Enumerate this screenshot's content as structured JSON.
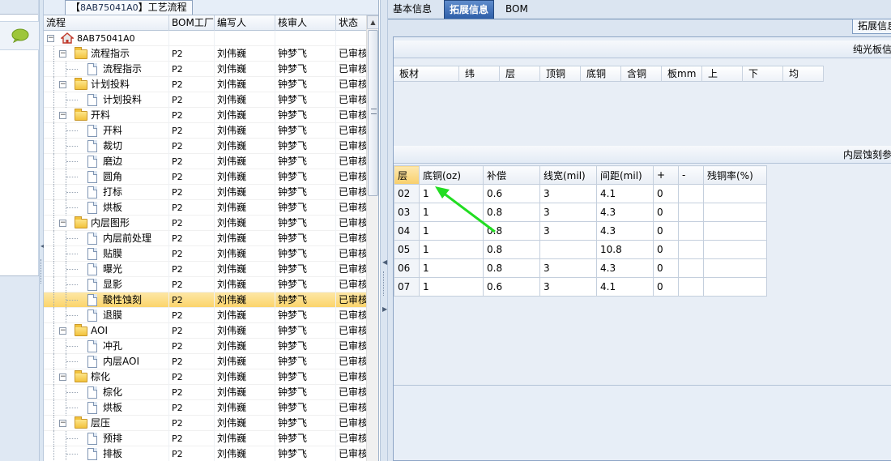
{
  "tree_panel": {
    "title_prefix": "【",
    "title_code": "8AB75041A0",
    "title_suffix": "】工艺流程",
    "columns": [
      "流程",
      "BOM工厂",
      "编写人",
      "核审人",
      "状态"
    ]
  },
  "tree_rows": [
    {
      "name": "8AB75041A0",
      "type": "root",
      "level": 0,
      "factory": "",
      "author": "",
      "reviewer": "",
      "status": ""
    },
    {
      "name": "流程指示",
      "type": "folder",
      "level": 1,
      "factory": "P2",
      "author": "刘伟巍",
      "reviewer": "钟梦飞",
      "status": "已审核"
    },
    {
      "name": "流程指示",
      "type": "doc",
      "level": 2,
      "factory": "P2",
      "author": "刘伟巍",
      "reviewer": "钟梦飞",
      "status": "已审核"
    },
    {
      "name": "计划投料",
      "type": "folder",
      "level": 1,
      "factory": "P2",
      "author": "刘伟巍",
      "reviewer": "钟梦飞",
      "status": "已审核"
    },
    {
      "name": "计划投料",
      "type": "doc",
      "level": 2,
      "factory": "P2",
      "author": "刘伟巍",
      "reviewer": "钟梦飞",
      "status": "已审核"
    },
    {
      "name": "开料",
      "type": "folder",
      "level": 1,
      "factory": "P2",
      "author": "刘伟巍",
      "reviewer": "钟梦飞",
      "status": "已审核"
    },
    {
      "name": "开料",
      "type": "doc",
      "level": 2,
      "factory": "P2",
      "author": "刘伟巍",
      "reviewer": "钟梦飞",
      "status": "已审核"
    },
    {
      "name": "裁切",
      "type": "doc",
      "level": 2,
      "factory": "P2",
      "author": "刘伟巍",
      "reviewer": "钟梦飞",
      "status": "已审核"
    },
    {
      "name": "磨边",
      "type": "doc",
      "level": 2,
      "factory": "P2",
      "author": "刘伟巍",
      "reviewer": "钟梦飞",
      "status": "已审核"
    },
    {
      "name": "圆角",
      "type": "doc",
      "level": 2,
      "factory": "P2",
      "author": "刘伟巍",
      "reviewer": "钟梦飞",
      "status": "已审核"
    },
    {
      "name": "打标",
      "type": "doc",
      "level": 2,
      "factory": "P2",
      "author": "刘伟巍",
      "reviewer": "钟梦飞",
      "status": "已审核"
    },
    {
      "name": "烘板",
      "type": "doc",
      "level": 2,
      "factory": "P2",
      "author": "刘伟巍",
      "reviewer": "钟梦飞",
      "status": "已审核"
    },
    {
      "name": "内层图形",
      "type": "folder",
      "level": 1,
      "factory": "P2",
      "author": "刘伟巍",
      "reviewer": "钟梦飞",
      "status": "已审核"
    },
    {
      "name": "内层前处理",
      "type": "doc",
      "level": 2,
      "factory": "P2",
      "author": "刘伟巍",
      "reviewer": "钟梦飞",
      "status": "已审核"
    },
    {
      "name": "贴膜",
      "type": "doc",
      "level": 2,
      "factory": "P2",
      "author": "刘伟巍",
      "reviewer": "钟梦飞",
      "status": "已审核"
    },
    {
      "name": "曝光",
      "type": "doc",
      "level": 2,
      "factory": "P2",
      "author": "刘伟巍",
      "reviewer": "钟梦飞",
      "status": "已审核"
    },
    {
      "name": "显影",
      "type": "doc",
      "level": 2,
      "factory": "P2",
      "author": "刘伟巍",
      "reviewer": "钟梦飞",
      "status": "已审核"
    },
    {
      "name": "酸性蚀刻",
      "type": "doc",
      "level": 2,
      "factory": "P2",
      "author": "刘伟巍",
      "reviewer": "钟梦飞",
      "status": "已审核",
      "selected": true
    },
    {
      "name": "退膜",
      "type": "doc",
      "level": 2,
      "factory": "P2",
      "author": "刘伟巍",
      "reviewer": "钟梦飞",
      "status": "已审核"
    },
    {
      "name": "AOI",
      "type": "folder",
      "level": 1,
      "factory": "P2",
      "author": "刘伟巍",
      "reviewer": "钟梦飞",
      "status": "已审核"
    },
    {
      "name": "冲孔",
      "type": "doc",
      "level": 2,
      "factory": "P2",
      "author": "刘伟巍",
      "reviewer": "钟梦飞",
      "status": "已审核"
    },
    {
      "name": "内层AOI",
      "type": "doc",
      "level": 2,
      "factory": "P2",
      "author": "刘伟巍",
      "reviewer": "钟梦飞",
      "status": "已审核"
    },
    {
      "name": "棕化",
      "type": "folder",
      "level": 1,
      "factory": "P2",
      "author": "刘伟巍",
      "reviewer": "钟梦飞",
      "status": "已审核"
    },
    {
      "name": "棕化",
      "type": "doc",
      "level": 2,
      "factory": "P2",
      "author": "刘伟巍",
      "reviewer": "钟梦飞",
      "status": "已审核"
    },
    {
      "name": "烘板",
      "type": "doc",
      "level": 2,
      "factory": "P2",
      "author": "刘伟巍",
      "reviewer": "钟梦飞",
      "status": "已审核"
    },
    {
      "name": "层压",
      "type": "folder",
      "level": 1,
      "factory": "P2",
      "author": "刘伟巍",
      "reviewer": "钟梦飞",
      "status": "已审核"
    },
    {
      "name": "预排",
      "type": "doc",
      "level": 2,
      "factory": "P2",
      "author": "刘伟巍",
      "reviewer": "钟梦飞",
      "status": "已审核"
    },
    {
      "name": "排板",
      "type": "doc",
      "level": 2,
      "factory": "P2",
      "author": "刘伟巍",
      "reviewer": "钟梦飞",
      "status": "已审核"
    }
  ],
  "tabs": [
    {
      "label": "基本信息",
      "active": false
    },
    {
      "label": "拓展信息",
      "active": true
    },
    {
      "label": "BOM",
      "active": false
    }
  ],
  "subtab_label": "拓展信息",
  "board_section": {
    "title": "纯光板信",
    "columns": [
      "板材",
      "纬",
      "层",
      "顶铜",
      "底铜",
      "含铜",
      "板mm",
      "上",
      "下",
      "均"
    ]
  },
  "etch_section": {
    "title": "内层蚀刻参",
    "columns": [
      "层",
      "底铜(oz)",
      "补偿",
      "线宽(mil)",
      "间距(mil)",
      "+",
      "-",
      "残铜率(%)"
    ],
    "rows": [
      [
        "02",
        "1",
        "0.6",
        "3",
        "4.1",
        "0",
        "",
        ""
      ],
      [
        "03",
        "1",
        "0.8",
        "3",
        "4.3",
        "0",
        "",
        ""
      ],
      [
        "04",
        "1",
        "0.8",
        "3",
        "4.3",
        "0",
        "",
        ""
      ],
      [
        "05",
        "1",
        "0.8",
        "",
        "10.8",
        "0",
        "",
        ""
      ],
      [
        "06",
        "1",
        "0.8",
        "3",
        "4.3",
        "0",
        "",
        ""
      ],
      [
        "07",
        "1",
        "0.6",
        "3",
        "4.1",
        "0",
        "",
        ""
      ]
    ]
  },
  "colors": {
    "selected_row": "#fbd46b",
    "active_tab": "#2e5fa8",
    "annotation_arrow": "#22dd22"
  }
}
